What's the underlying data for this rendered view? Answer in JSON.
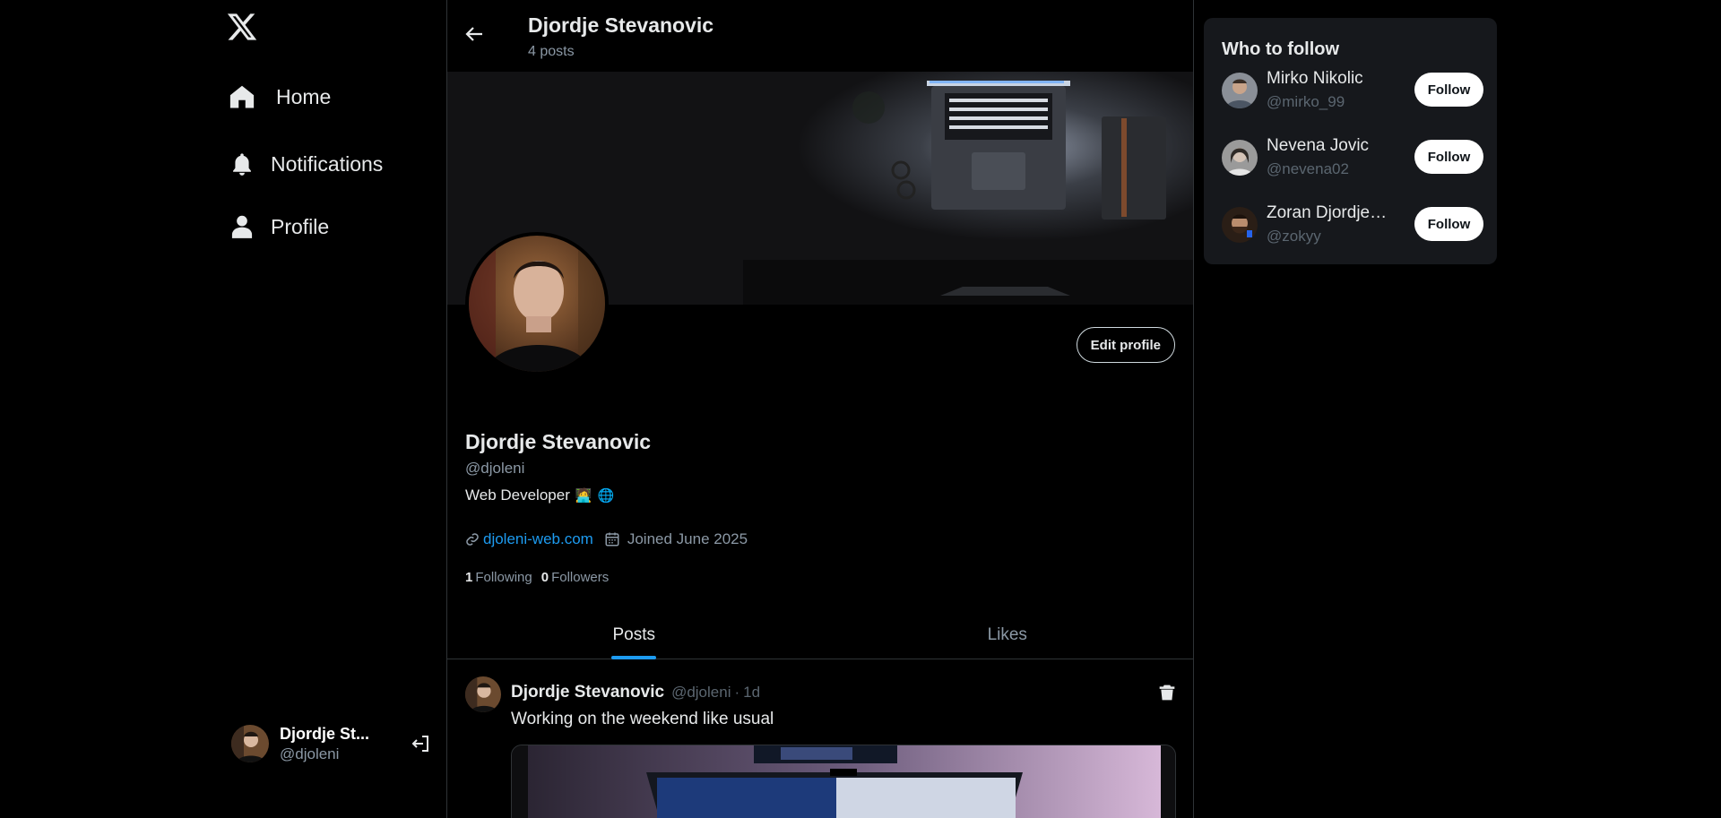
{
  "colors": {
    "background": "#000000",
    "accent": "#1d9bf0",
    "text": "#e7e9ea",
    "muted": "#8b98a5",
    "card": "#16181c"
  },
  "sidebar": {
    "logo_icon": "x-logo-icon",
    "items": [
      {
        "label": "Home",
        "icon": "home-icon"
      },
      {
        "label": "Notifications",
        "icon": "bell-icon"
      },
      {
        "label": "Profile",
        "icon": "person-icon"
      }
    ],
    "account": {
      "name": "Djordje St...",
      "handle": "@djoleni",
      "logout_icon": "logout-icon"
    }
  },
  "header": {
    "title": "Djordje Stevanovic",
    "subtitle": "4 posts"
  },
  "profile": {
    "edit_label": "Edit profile",
    "name": "Djordje Stevanovic",
    "handle": "@djoleni",
    "bio": "Web Developer",
    "bio_emojis": [
      "🧑‍💻",
      "🌐"
    ],
    "website": "djoleni-web.com",
    "joined": "Joined June 2025",
    "following_count": "1",
    "following_label": "Following",
    "followers_count": "0",
    "followers_label": "Followers"
  },
  "tabs": [
    {
      "label": "Posts",
      "active": true
    },
    {
      "label": "Likes",
      "active": false
    }
  ],
  "post": {
    "author": "Djordje Stevanovic",
    "handle": "@djoleni",
    "separator": "·",
    "time": "1d",
    "text": "Working on the weekend like usual"
  },
  "who_to_follow": {
    "title": "Who to follow",
    "users": [
      {
        "name": "Mirko Nikolic",
        "handle": "@mirko_99",
        "button": "Follow"
      },
      {
        "name": "Nevena Jovic",
        "handle": "@nevena02",
        "button": "Follow"
      },
      {
        "name": "Zoran Djordjevic",
        "handle": "@zokyy",
        "button": "Follow"
      }
    ]
  }
}
